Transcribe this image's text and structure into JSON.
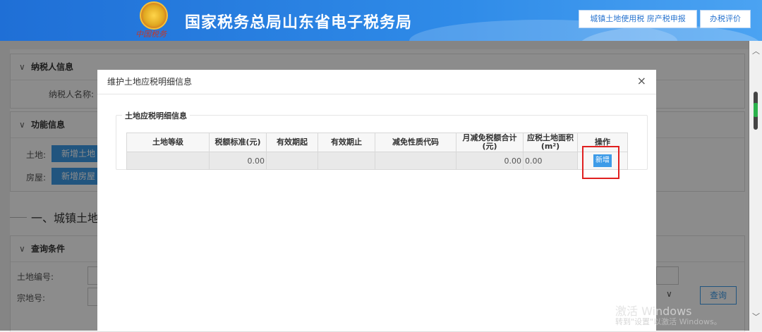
{
  "header": {
    "emblem_caption": "中国税务",
    "title": "国家税务总局山东省电子税务局",
    "buttons": [
      "城镇土地使用税 房产税申报",
      "办税评价"
    ]
  },
  "background_page": {
    "taxpayer_panel": {
      "title": "纳税人信息",
      "name_label": "纳税人名称:"
    },
    "function_panel": {
      "title": "功能信息",
      "land_label": "土地:",
      "land_button": "新增土地",
      "house_label": "房屋:",
      "house_button": "新增房屋"
    },
    "section_title": "一、城镇土地亻",
    "query_panel": {
      "title": "查询条件",
      "land_no_label": "土地编号:",
      "parcel_no_label": "宗地号:",
      "query_button": "查询"
    }
  },
  "modal": {
    "title": "维护土地应税明细信息",
    "close_symbol": "×",
    "fieldset_legend": "土地应税明细信息",
    "columns": [
      "土地等级",
      "税额标准(元)",
      "有效期起",
      "有效期止",
      "减免性质代码",
      "月减免税额合计(元)",
      "应税土地面积(m²)",
      "操作"
    ],
    "row": {
      "land_grade": "",
      "tax_standard": "0.00",
      "valid_from": "",
      "valid_to": "",
      "relief_code": "",
      "monthly_relief_total": "0.00",
      "taxable_area": "0.00",
      "action_button": "新增"
    }
  },
  "watermark": {
    "line1": "激活 Windows",
    "line2": "转到\"设置\"以激活 Windows。"
  },
  "colors": {
    "header_blue": "#2f8be8",
    "button_blue": "#3d9be8",
    "highlight_red": "#e02020"
  }
}
